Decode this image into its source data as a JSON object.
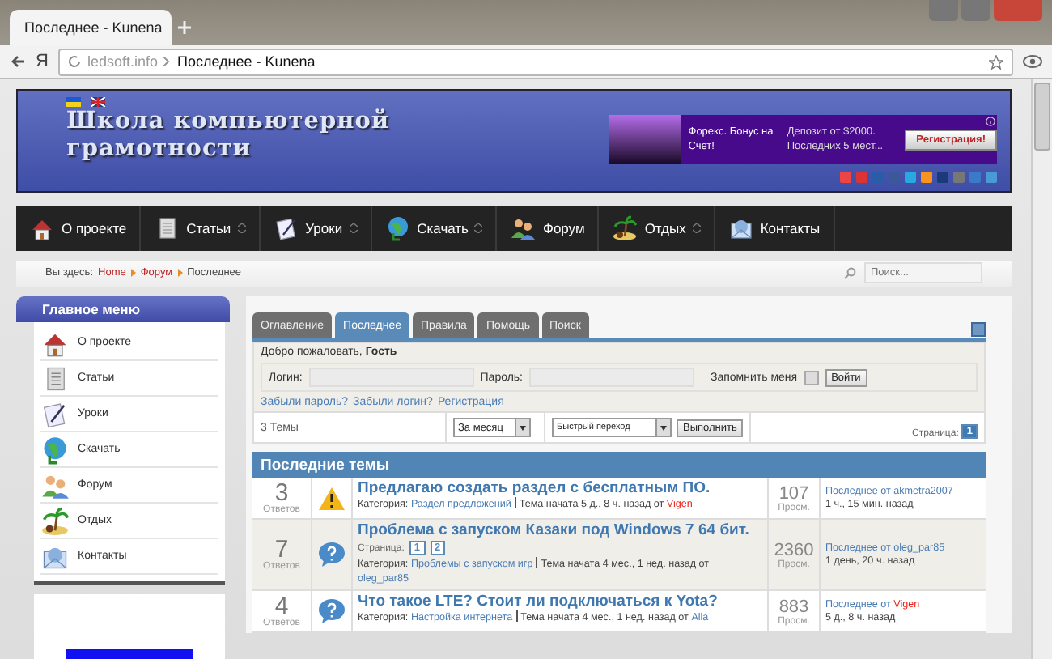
{
  "browser": {
    "tab_title": "Последнее - Kunena",
    "address_domain": "ledsoft.info",
    "address_title": "Последнее - Kunena",
    "back_label": "Я"
  },
  "header": {
    "title_lines": [
      "Школа компьютерной",
      "грамотности"
    ],
    "ad": {
      "text": "Форекс. Бонус на Счет!",
      "offer": "Депозит от $2000. Последних 5 мест...",
      "button": "Регистрация!"
    }
  },
  "nav": [
    {
      "label": "О проекте",
      "kind": "home",
      "has_submenu": false
    },
    {
      "label": "Статьи",
      "kind": "doc",
      "has_submenu": true
    },
    {
      "label": "Уроки",
      "kind": "lessons",
      "has_submenu": true
    },
    {
      "label": "Скачать",
      "kind": "download",
      "has_submenu": true
    },
    {
      "label": "Форум",
      "kind": "forum",
      "has_submenu": false
    },
    {
      "label": "Отдых",
      "kind": "rest",
      "has_submenu": true
    },
    {
      "label": "Контакты",
      "kind": "contacts",
      "has_submenu": false
    }
  ],
  "breadcrumb": {
    "label": "Вы здесь:",
    "items": [
      "Home",
      "Форум",
      "Последнее"
    ],
    "search_placeholder": "Поиск..."
  },
  "sidebar": {
    "title": "Главное меню",
    "items": [
      {
        "label": "О проекте",
        "kind": "home"
      },
      {
        "label": "Статьи",
        "kind": "doc"
      },
      {
        "label": "Уроки",
        "kind": "lessons"
      },
      {
        "label": "Скачать",
        "kind": "download"
      },
      {
        "label": "Форум",
        "kind": "forum"
      },
      {
        "label": "Отдых",
        "kind": "rest"
      },
      {
        "label": "Контакты",
        "kind": "contacts"
      }
    ]
  },
  "forum": {
    "tabs": [
      {
        "label": "Оглавление",
        "selected": false
      },
      {
        "label": "Последнее",
        "selected": true
      },
      {
        "label": "Правила",
        "selected": false
      },
      {
        "label": "Помощь",
        "selected": false
      },
      {
        "label": "Поиск",
        "selected": false
      }
    ],
    "welcome": "Добро пожаловать, **Гость**",
    "login_label": "Логин:",
    "password_label": "Пароль:",
    "remember_label": "Запомнить меня",
    "remember_checked": false,
    "login_button": "Войти",
    "links": [
      "Забыли пароль?",
      "Забыли логин?",
      "Регистрация"
    ],
    "topic_count": "3 Темы",
    "period": "За месяц",
    "jump": "Быстрый переход",
    "go_button": "Выполнить",
    "pages_label": "Страница:",
    "pages": [
      {
        "label": "1",
        "selected": true
      }
    ],
    "section_title": "Последние темы",
    "topics": [
      {
        "replies": "3",
        "replies_label": "Ответов",
        "kind": "warning",
        "title": "Предлагаю создать раздел с бесплатным ПО.",
        "category_label": "Категория:",
        "category": "Раздел предложений",
        "started": "Тема начата 5 д., 8 ч. назад от",
        "author": {
          "name": "Vigen",
          "color": "#e8251c"
        },
        "views": "107",
        "views_label": "Просм.",
        "last_label": "Последнее от",
        "last_author": {
          "name": "akmetra2007",
          "color": "#4a7db5"
        },
        "last_time": "1 ч., 15 мин. назад"
      },
      {
        "replies": "7",
        "replies_label": "Ответов",
        "kind": "question",
        "title": "Проблема с запуском Казаки под Windows 7 64 бит.",
        "pages_label": "Страница:",
        "pages": [
          "1",
          "2"
        ],
        "category_label": "Категория:",
        "category": "Проблемы с запуском игр",
        "started": "Тема начата 4 мес., 1 нед. назад от",
        "author": {
          "name": "oleg_par85",
          "color": "#4a7db5"
        },
        "views": "2360",
        "views_label": "Просм.",
        "last_label": "Последнее от",
        "last_author": {
          "name": "oleg_par85",
          "color": "#4a7db5"
        },
        "last_time": "1 день, 20 ч. назад"
      },
      {
        "replies": "4",
        "replies_label": "Ответов",
        "kind": "question",
        "title": "Что такое LTE? Стоит ли подключаться к Yota?",
        "category_label": "Категория:",
        "category": "Настройка интернета",
        "started": "Тема начата 4 мес., 1 нед. назад от",
        "author": {
          "name": "Alla",
          "color": "#4a7db5"
        },
        "views": "883",
        "views_label": "Просм.",
        "last_label": "Последнее от",
        "last_author": {
          "name": "Vigen",
          "color": "#e8251c"
        },
        "last_time": "5 д., 8 ч. назад"
      }
    ]
  }
}
